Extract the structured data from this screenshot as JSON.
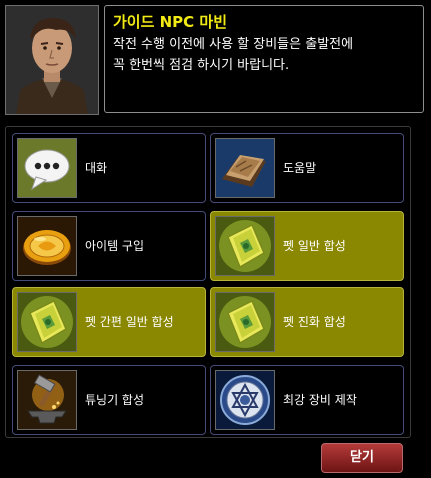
{
  "npc": {
    "name": "가이드 NPC 마빈",
    "message_line1": "작전 수행 이전에 사용 할 장비들은 출발전에",
    "message_line2": "꼭 한번씩 점검 하시기 바랍니다."
  },
  "menu": {
    "items": [
      {
        "label": "대화",
        "icon": "speech-bubble-icon",
        "highlighted": false
      },
      {
        "label": "도움말",
        "icon": "help-book-icon",
        "highlighted": false
      },
      {
        "label": "아이템 구입",
        "icon": "gold-coin-icon",
        "highlighted": false
      },
      {
        "label": "펫 일반 합성",
        "icon": "pet-card-icon",
        "highlighted": true
      },
      {
        "label": "펫 간편 일반 합성",
        "icon": "pet-card-icon",
        "highlighted": true
      },
      {
        "label": "펫 진화 합성",
        "icon": "pet-card-icon",
        "highlighted": true
      },
      {
        "label": "튜닝기 합성",
        "icon": "hammer-anvil-icon",
        "highlighted": false
      },
      {
        "label": "최강 장비 제작",
        "icon": "emblem-icon",
        "highlighted": false
      }
    ]
  },
  "footer": {
    "close_label": "닫기"
  },
  "colors": {
    "npc_name": "#f2ea14",
    "highlight_bg": "#8a8700",
    "close_button": "#9a2a2a"
  }
}
